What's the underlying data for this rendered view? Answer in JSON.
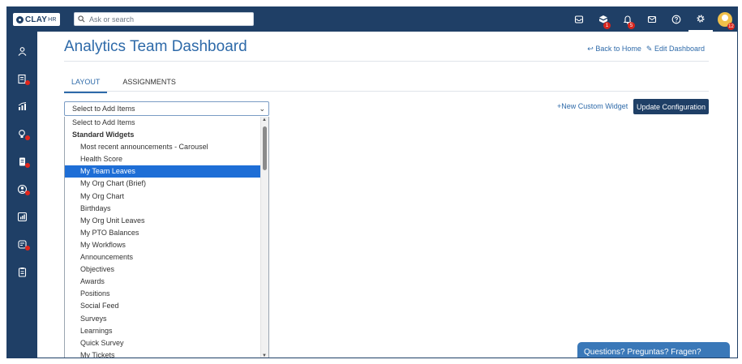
{
  "topbar": {
    "logo_text": "CLAY",
    "logo_suffix": "HR",
    "search_placeholder": "Ask or search",
    "icons": [
      {
        "name": "inbox-icon",
        "badge": ""
      },
      {
        "name": "box-icon",
        "badge": "1"
      },
      {
        "name": "bell-icon",
        "badge": "5"
      },
      {
        "name": "mail-icon",
        "badge": ""
      },
      {
        "name": "help-icon",
        "badge": ""
      },
      {
        "name": "gear-icon",
        "badge": ""
      }
    ],
    "avatar_badge": "12"
  },
  "sidebar": {
    "items": [
      {
        "name": "people-icon",
        "dot": false
      },
      {
        "name": "id-card-icon",
        "dot": true
      },
      {
        "name": "analytics-icon",
        "dot": false
      },
      {
        "name": "lightbulb-icon",
        "dot": true
      },
      {
        "name": "document-icon",
        "dot": true
      },
      {
        "name": "user-circle-icon",
        "dot": true
      },
      {
        "name": "report-icon",
        "dot": false
      },
      {
        "name": "timesheet-icon",
        "dot": true
      },
      {
        "name": "clipboard-icon",
        "dot": false
      }
    ]
  },
  "page": {
    "title": "Analytics Team Dashboard",
    "back_home": "Back to Home",
    "edit_dashboard": "Edit Dashboard"
  },
  "tabs": [
    {
      "label": "LAYOUT",
      "active": true
    },
    {
      "label": "ASSIGNMENTS",
      "active": false
    }
  ],
  "select": {
    "value": "Select to Add Items",
    "options": [
      {
        "label": "Select to Add Items",
        "kind": "first"
      },
      {
        "label": "Standard Widgets",
        "kind": "group"
      },
      {
        "label": "Most recent announcements - Carousel",
        "kind": "item"
      },
      {
        "label": "Health Score",
        "kind": "item"
      },
      {
        "label": "My Team Leaves",
        "kind": "selected"
      },
      {
        "label": "My Org Chart (Brief)",
        "kind": "item"
      },
      {
        "label": "My Org Chart",
        "kind": "item"
      },
      {
        "label": "Birthdays",
        "kind": "item"
      },
      {
        "label": "My Org Unit Leaves",
        "kind": "item"
      },
      {
        "label": "My PTO Balances",
        "kind": "item"
      },
      {
        "label": "My Workflows",
        "kind": "item"
      },
      {
        "label": "Announcements",
        "kind": "item"
      },
      {
        "label": "Objectives",
        "kind": "item"
      },
      {
        "label": "Awards",
        "kind": "item"
      },
      {
        "label": "Positions",
        "kind": "item"
      },
      {
        "label": "Social Feed",
        "kind": "item"
      },
      {
        "label": "Surveys",
        "kind": "item"
      },
      {
        "label": "Learnings",
        "kind": "item"
      },
      {
        "label": "Quick Survey",
        "kind": "item"
      },
      {
        "label": "My Tickets",
        "kind": "item"
      }
    ]
  },
  "actions": {
    "new_widget": "New Custom Widget",
    "update": "Update Configuration"
  },
  "chat": {
    "label": "Questions? Preguntas? Fragen?"
  },
  "colors": {
    "navy": "#1f3f66",
    "link_blue": "#2e6aa9",
    "selected": "#1e6ed6",
    "badge_red": "#d7261e"
  }
}
